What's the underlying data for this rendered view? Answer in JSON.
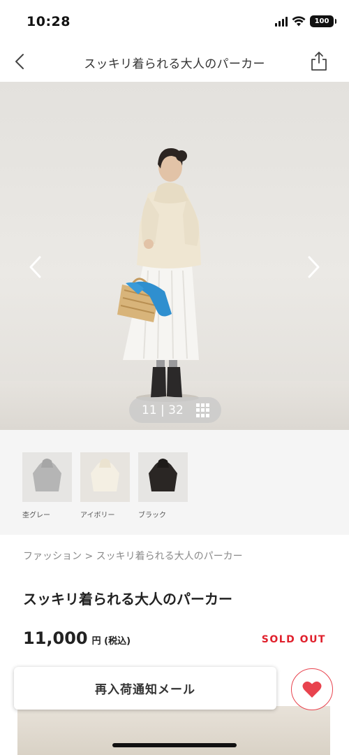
{
  "status_bar": {
    "time": "10:28",
    "battery": "100",
    "icons": [
      "signal-icon",
      "wifi-icon",
      "battery-icon"
    ]
  },
  "nav": {
    "back_icon": "chevron-left-icon",
    "title": "スッキリ着られる大人のパーカー",
    "share_icon": "share-icon"
  },
  "gallery": {
    "current": "11",
    "separator": "|",
    "total": "32",
    "counter_text": "11 | 32",
    "prev_icon": "chevron-left-icon",
    "next_icon": "chevron-right-icon",
    "grid_icon": "grid-icon"
  },
  "colors": [
    {
      "label": "杢グレー",
      "swatch": "#b9b9b9"
    },
    {
      "label": "アイボリー",
      "swatch": "#f1ece0"
    },
    {
      "label": "ブラック",
      "swatch": "#2a2624"
    }
  ],
  "product": {
    "breadcrumb": "ファッション > スッキリ着られる大人のパーカー",
    "title": "スッキリ着られる大人のパーカー",
    "price": "11,000",
    "price_unit": "円 (税込)",
    "stock_status": "SOLD OUT"
  },
  "actions": {
    "notify_label": "再入荷通知メール",
    "favorite_icon": "heart-icon"
  },
  "theme": {
    "accent": "#e0202c",
    "heart": "#e8434e"
  }
}
